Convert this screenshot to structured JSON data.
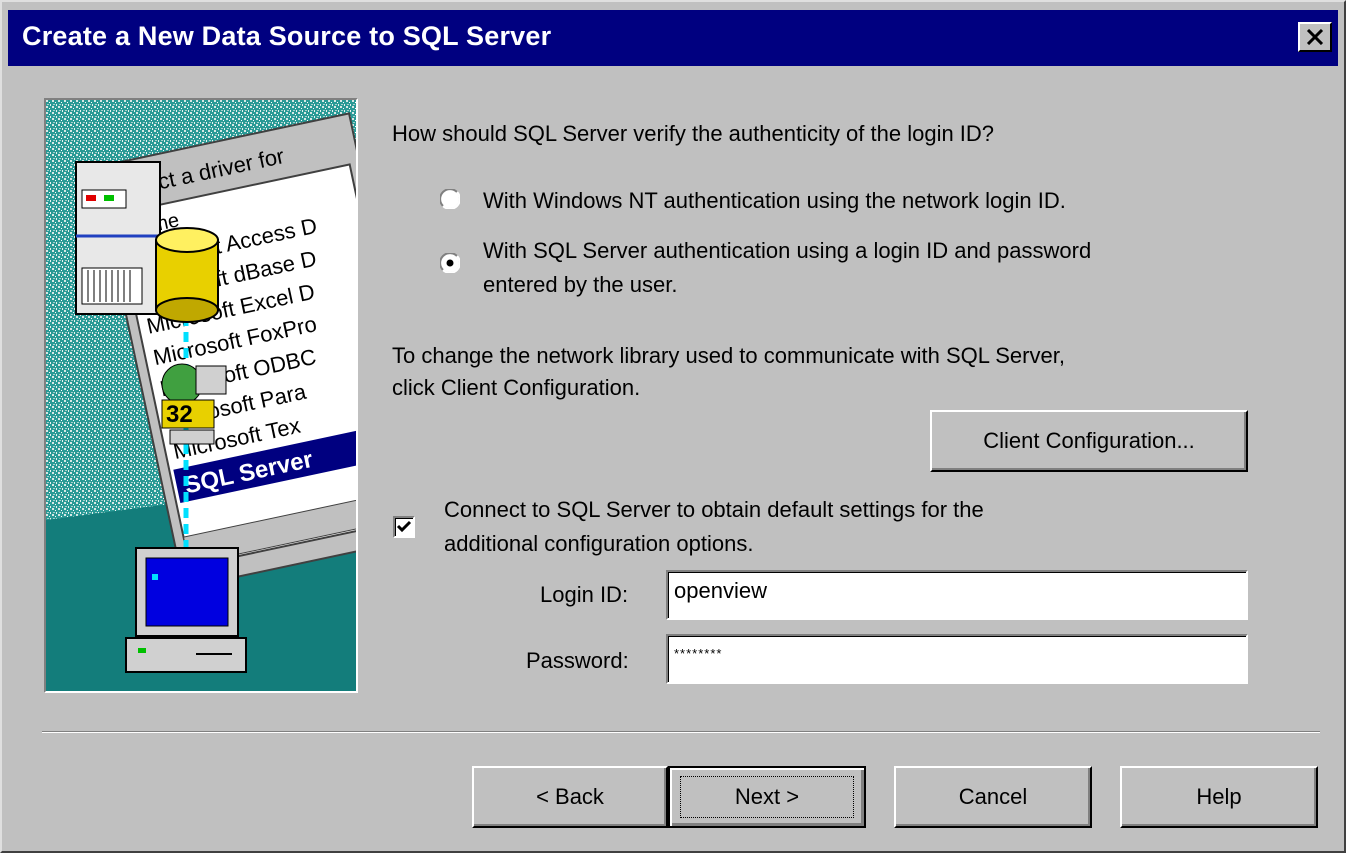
{
  "window": {
    "title": "Create a New Data Source to SQL Server"
  },
  "illustration": {
    "list_header": "Select a driver for",
    "name_header": "Name",
    "drivers": [
      "Microsoft Access D",
      "Microsoft dBase D",
      "Microsoft Excel D",
      "Microsoft FoxPro",
      "Microsoft ODBC",
      "Microsoft Para",
      "Microsoft Tex",
      "SQL Server"
    ],
    "badge": "32"
  },
  "auth": {
    "question": "How should SQL Server verify the authenticity of the login ID?",
    "options": [
      {
        "line1": "With Windows NT authentication using the network login ID.",
        "line2": "",
        "selected": false
      },
      {
        "line1": "With SQL Server authentication using a login ID and password",
        "line2": "entered by the user.",
        "selected": true
      }
    ]
  },
  "network": {
    "text_line1": "To change the network library used to communicate with SQL Server,",
    "text_line2": "click Client Configuration.",
    "client_config_label": "Client Configuration..."
  },
  "connect": {
    "checked": true,
    "line1": "Connect to SQL Server to obtain default settings for the",
    "line2": "additional configuration options."
  },
  "credentials": {
    "login_label": "Login ID:",
    "login_value": "openview",
    "password_label": "Password:",
    "password_value": "********"
  },
  "buttons": {
    "back": "< Back",
    "next": "Next >",
    "cancel": "Cancel",
    "help": "Help"
  },
  "colors": {
    "title_bar": "#000080",
    "dialog_face": "#c0c0c0",
    "illustration_teal": "#1a8a8a"
  }
}
